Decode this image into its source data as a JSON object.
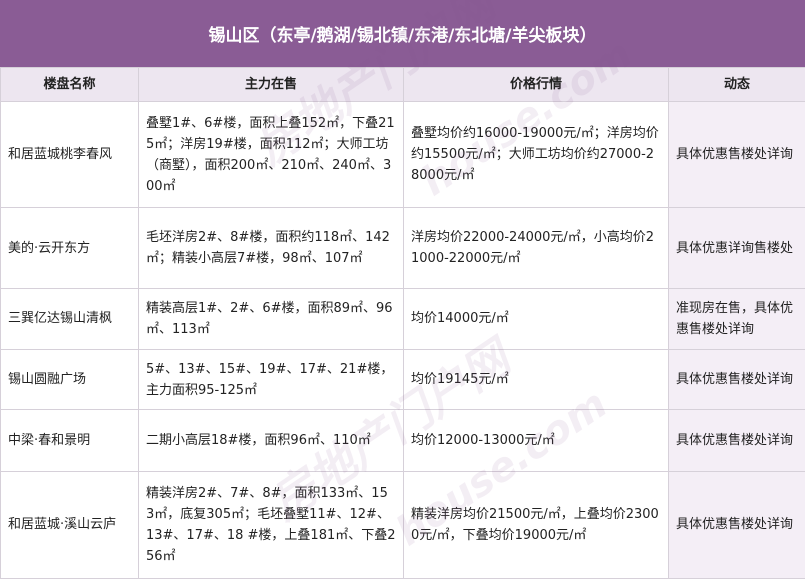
{
  "title": "锡山区（东亭/鹅湖/锡北镇/东港/东北塘/羊尖板块）",
  "headers": [
    "楼盘名称",
    "主力在售",
    "价格行情",
    "动态"
  ],
  "rows": [
    {
      "name": "和居蓝城桃李春风",
      "sale": "叠墅1#、6#楼，面积上叠152㎡，下叠215㎡；洋房19#楼，面积112㎡；大师工坊（商墅），面积200㎡、210㎡、240㎡、300㎡",
      "price": "叠墅均价约16000-19000元/㎡；洋房均价约15500元/㎡；大师工坊均价约27000-28000元/㎡",
      "status": "具体优惠售楼处详询"
    },
    {
      "name": "美的·云开东方",
      "sale": "毛坯洋房2#、8#楼，面积约118㎡、142㎡；精装小高层7#楼，98㎡、107㎡",
      "price": "洋房均价22000-24000元/㎡，小高均价21000-22000元/㎡",
      "status": "具体优惠详询售楼处"
    },
    {
      "name": "三巽亿达锡山清枫",
      "sale": "精装高层1#、2#、6#楼，面积89㎡、96㎡、113㎡",
      "price": "均价14000元/㎡",
      "status": "准现房在售，具体优惠售楼处详询"
    },
    {
      "name": "锡山圆融广场",
      "sale": "5#、13#、15#、19#、17#、21#楼，主力面积95-125㎡",
      "price": "均价19145元/㎡",
      "status": "具体优惠售楼处详询"
    },
    {
      "name": "中梁·春和景明",
      "sale": "二期小高层18#楼，面积96㎡、110㎡",
      "price": "均价12000-13000元/㎡",
      "status": "具体优惠售楼处详询"
    },
    {
      "name": "和居蓝城·溪山云庐",
      "sale": "精装洋房2#、7#、8#，面积133㎡、153㎡，底复305㎡；毛坯叠墅11#、12#、13#、17#、18 #楼，上叠181㎡、下叠256㎡",
      "price": "精装洋房均价21500元/㎡，上叠均价23000元/㎡，下叠均价19000元/㎡",
      "status": "具体优惠售楼处详询"
    }
  ],
  "watermark": {
    "text_cn": "房地产门户网",
    "text_en": "house.com",
    "color": "#8a5c95"
  },
  "colors": {
    "title_bg": "#8a5c95",
    "header_bg": "#ede6f0",
    "status_bg": "#f4eef6",
    "border": "#d6d0d9"
  }
}
